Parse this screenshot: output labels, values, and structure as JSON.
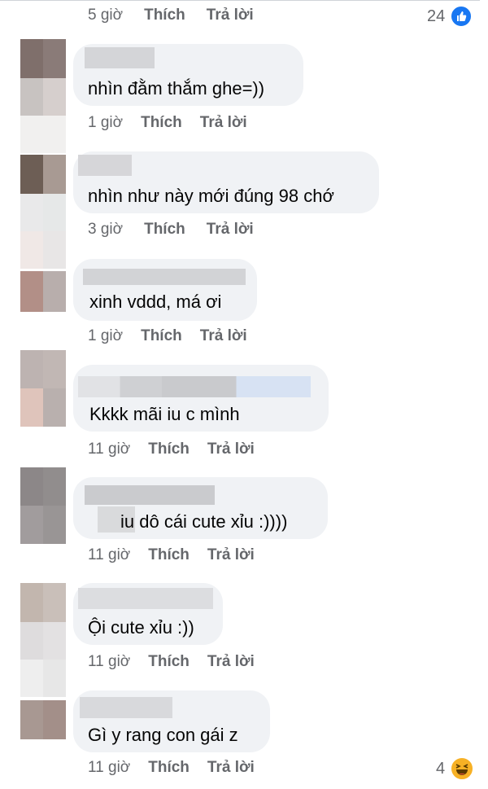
{
  "actions": {
    "like": "Thích",
    "reply": "Trả lời"
  },
  "top_row": {
    "time": "5 giờ",
    "reaction_count": "24",
    "reaction_icon": "like-icon"
  },
  "comments": [
    {
      "text": "nhìn đằm thắm ghe=))",
      "time": "1 giờ"
    },
    {
      "text": "nhìn như này mới đúng 98 chớ",
      "time": "3 giờ"
    },
    {
      "text": "xinh vddd, má ơi",
      "time": "1 giờ"
    },
    {
      "text": "Kkkk mãi iu c mình",
      "time": "11 giờ"
    },
    {
      "text": "iu dô cái cute xỉu :))))",
      "time": "11 giờ"
    },
    {
      "text": "Ội cute xỉu :))",
      "time": "11 giờ"
    },
    {
      "text": "Gì y rang con gái z",
      "time": "11 giờ",
      "reaction_count": "4",
      "reaction_icon": "haha-icon"
    }
  ],
  "colors": {
    "bubble": "#f0f2f5",
    "meta": "#65676b",
    "like": "#1877f2",
    "haha": "#f7b125"
  }
}
